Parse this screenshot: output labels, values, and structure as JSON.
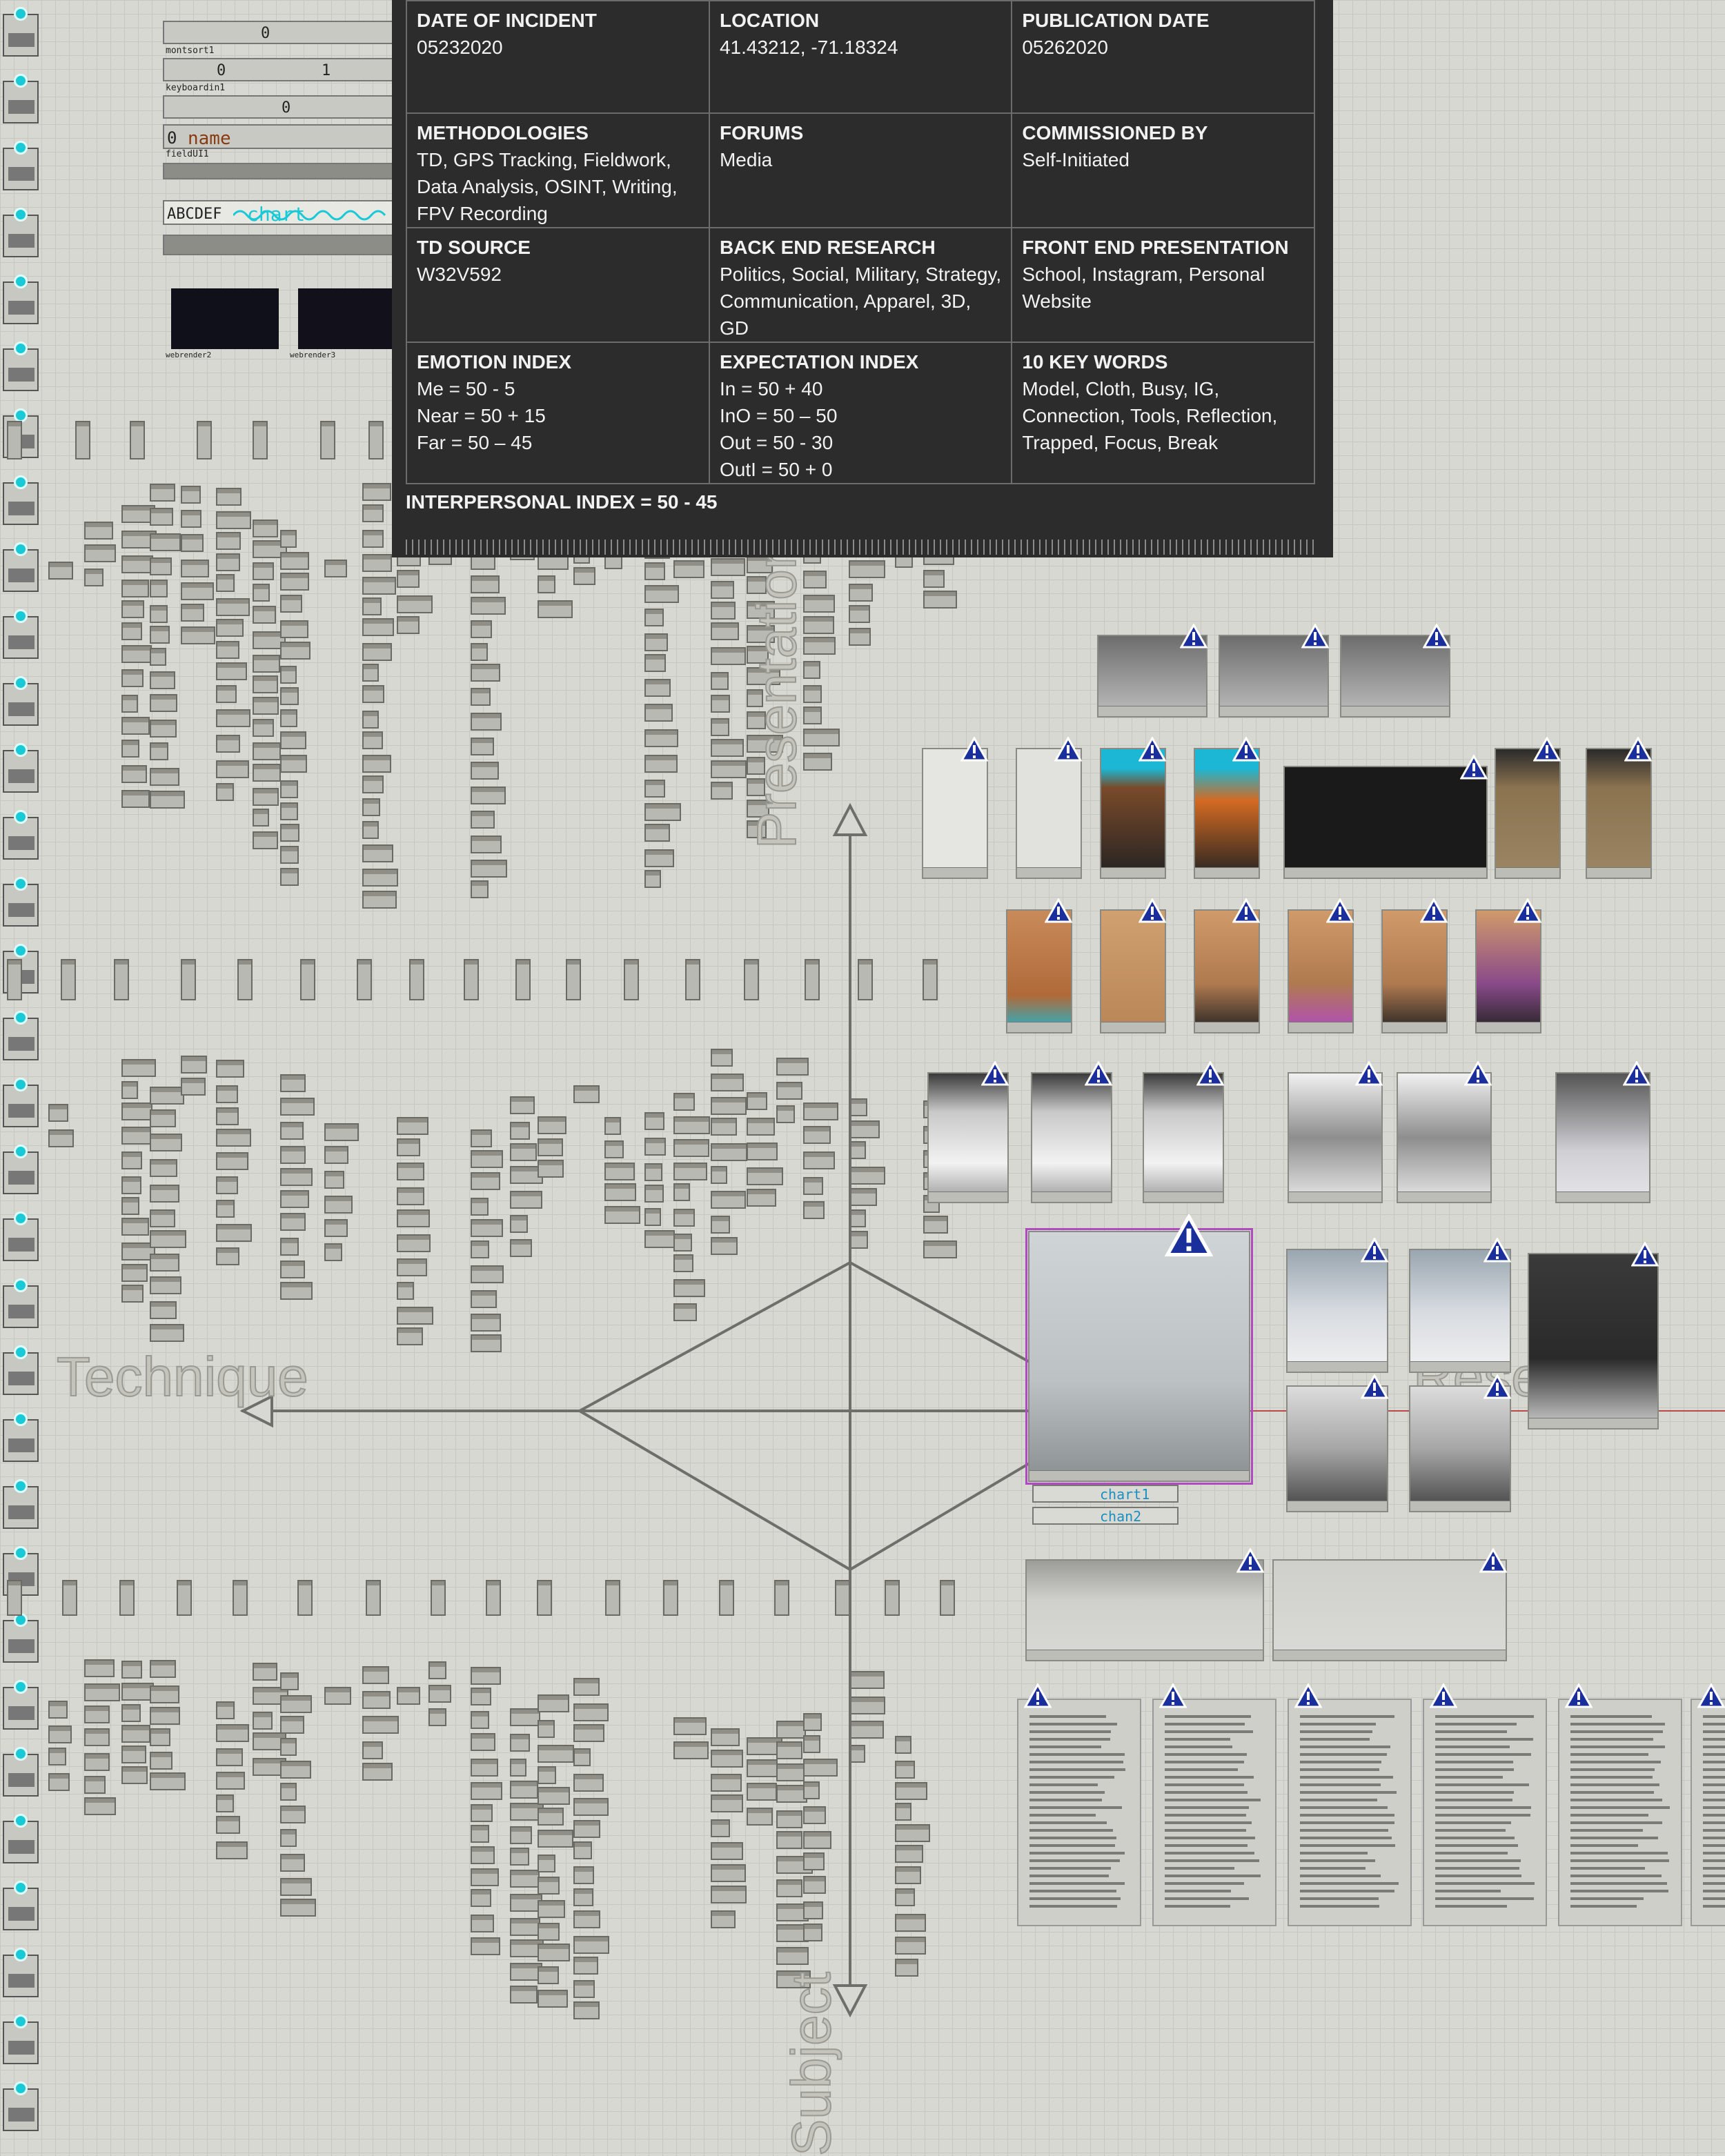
{
  "panel": {
    "cells": [
      [
        {
          "h": "DATE OF INCIDENT",
          "v": "05232020"
        },
        {
          "h": "LOCATION",
          "v": "41.43212, -71.18324"
        },
        {
          "h": "PUBLICATION DATE",
          "v": "05262020"
        }
      ],
      [
        {
          "h": "METHODOLOGIES",
          "v": "TD, GPS Tracking, Fieldwork, Data Analysis, OSINT, Writing, FPV Recording"
        },
        {
          "h": "FORUMS",
          "v": "Media"
        },
        {
          "h": "COMMISSIONED BY",
          "v": "Self-Initiated"
        }
      ],
      [
        {
          "h": "TD SOURCE",
          "v": "W32V592"
        },
        {
          "h": "BACK END RESEARCH",
          "v": "Politics, Social, Military, Strategy, Communication, Apparel, 3D, GD"
        },
        {
          "h": "FRONT END PRESENTATION",
          "v": "School, Instagram, Personal Website"
        }
      ],
      [
        {
          "h": "EMOTION INDEX",
          "lines": [
            "Me = 50 - 5",
            "Near = 50 + 15",
            "Far = 50 – 45"
          ]
        },
        {
          "h": "EXPECTATION INDEX",
          "lines": [
            "In = 50 + 40",
            "InO = 50 – 50",
            "Out = 50 - 30",
            "OutI = 50 + 0"
          ]
        },
        {
          "h": "10 KEY WORDS",
          "v": "Model, Cloth, Busy, IG, Connection, Tools, Reflection, Trapped, Focus, Break"
        }
      ]
    ],
    "interpersonal": "INTERPERSONAL INDEX = 50 - 45"
  },
  "widgets": {
    "slider1_value": "0",
    "slider1_label": "montsort1",
    "slider2_left": "0",
    "slider2_right": "1",
    "slider2_label": "keyboardin1",
    "slider3_value": "0",
    "field_index": "0",
    "field_name": "name",
    "field_label": "fieldUI1",
    "chart_word": "chart",
    "chart_prefix": "ABCDEF",
    "thumb1_label": "webrender2",
    "thumb2_label": "webrender3",
    "chan1_label": "chart1",
    "chan2_label": "chan2"
  },
  "axis_labels": {
    "left": "Technique",
    "right": "Research",
    "top": "Presentation",
    "bottom": "Subject"
  },
  "accent_colors": {
    "cyan": "#19c9d6",
    "purple": "#b04ac0",
    "warn_blue": "#1a2f9c"
  }
}
